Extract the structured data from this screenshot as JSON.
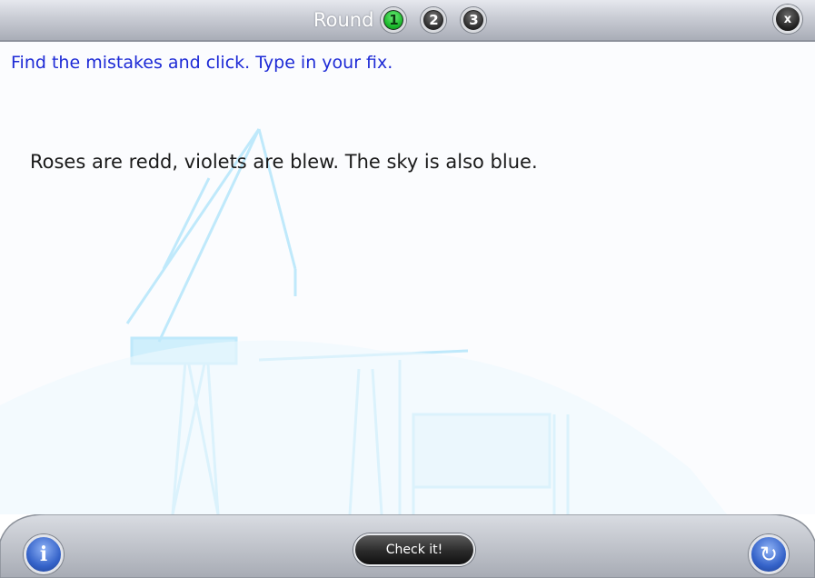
{
  "header": {
    "round_label": "Round",
    "rounds": [
      {
        "label": "1",
        "state": "active"
      },
      {
        "label": "2",
        "state": "inactive"
      },
      {
        "label": "3",
        "state": "inactive"
      }
    ],
    "close_label": "x"
  },
  "main": {
    "instruction": "Find the mistakes and click. Type in your fix.",
    "sentence": "Roses are redd, violets are blew. The sky is also blue."
  },
  "footer": {
    "check_label": "Check it!",
    "info_icon": "info-icon",
    "refresh_icon": "refresh-icon"
  },
  "colors": {
    "instruction": "#1d2ad6",
    "active_round": "#19b72a",
    "background_illustration": "#bfe9fb"
  }
}
